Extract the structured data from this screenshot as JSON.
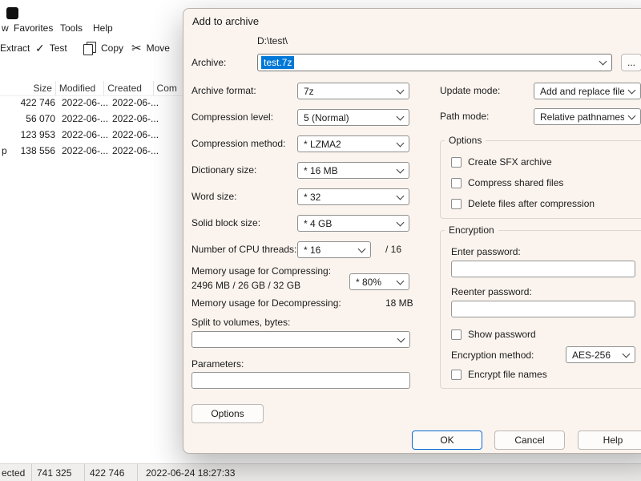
{
  "icons": {
    "check": "✓",
    "scissors": "✂"
  },
  "background_window": {
    "menu_partial": "w",
    "menu_items": [
      "Favorites",
      "Tools",
      "Help"
    ],
    "toolbar": {
      "extract": "Extract",
      "test": "Test",
      "copy": "Copy",
      "move": "Move"
    },
    "list": {
      "columns": {
        "size": "Size",
        "modified": "Modified",
        "created": "Created",
        "com": "Com"
      },
      "rows": [
        {
          "name": "",
          "size": "422 746",
          "modified": "2022-06-...",
          "created": "2022-06-..."
        },
        {
          "name": "",
          "size": "56 070",
          "modified": "2022-06-...",
          "created": "2022-06-..."
        },
        {
          "name": "",
          "size": "123 953",
          "modified": "2022-06-...",
          "created": "2022-06-..."
        },
        {
          "name": "p",
          "size": "138 556",
          "modified": "2022-06-...",
          "created": "2022-06-..."
        }
      ]
    },
    "statusbar": {
      "selected": "ected",
      "v1": "741 325",
      "v2": "422 746",
      "v3": "2022-06-24 18:27:33"
    }
  },
  "dialog": {
    "title": "Add to archive",
    "archive_label": "Archive:",
    "archive_dir": "D:\\test\\",
    "archive_name": "test.7z",
    "browse": "...",
    "fields": {
      "archive_format": {
        "label": "Archive format:",
        "value": "7z"
      },
      "compression_level": {
        "label": "Compression level:",
        "value": "5 (Normal)"
      },
      "compression_method": {
        "label": "Compression method:",
        "value": "* LZMA2"
      },
      "dictionary_size": {
        "label": "Dictionary size:",
        "value": "* 16 MB"
      },
      "word_size": {
        "label": "Word size:",
        "value": "* 32"
      },
      "solid_block_size": {
        "label": "Solid block size:",
        "value": "* 4 GB"
      },
      "cpu_threads": {
        "label": "Number of CPU threads:",
        "value": "* 16",
        "suffix": "/ 16"
      },
      "mem_compress": {
        "label": "Memory usage for Compressing:",
        "detail": "2496 MB / 26 GB / 32 GB",
        "value": "* 80%"
      },
      "mem_decompress": {
        "label": "Memory usage for Decompressing:",
        "value": "18 MB"
      },
      "split": {
        "label": "Split to volumes, bytes:",
        "value": ""
      },
      "parameters": {
        "label": "Parameters:",
        "value": ""
      },
      "update_mode": {
        "label": "Update mode:",
        "value": "Add and replace files"
      },
      "path_mode": {
        "label": "Path mode:",
        "value": "Relative pathnames"
      },
      "encryption_method": {
        "label": "Encryption method:",
        "value": "AES-256"
      }
    },
    "options_group": {
      "title": "Options",
      "sfx": "Create SFX archive",
      "shared": "Compress shared files",
      "delete": "Delete files after compression"
    },
    "encryption_group": {
      "title": "Encryption",
      "enter": "Enter password:",
      "reenter": "Reenter password:",
      "show": "Show password",
      "encrypt_names": "Encrypt file names"
    },
    "buttons": {
      "options": "Options",
      "ok": "OK",
      "cancel": "Cancel",
      "help": "Help"
    },
    "colors": {
      "selection": "#0078d7",
      "accent": "#0a6cd6"
    }
  }
}
